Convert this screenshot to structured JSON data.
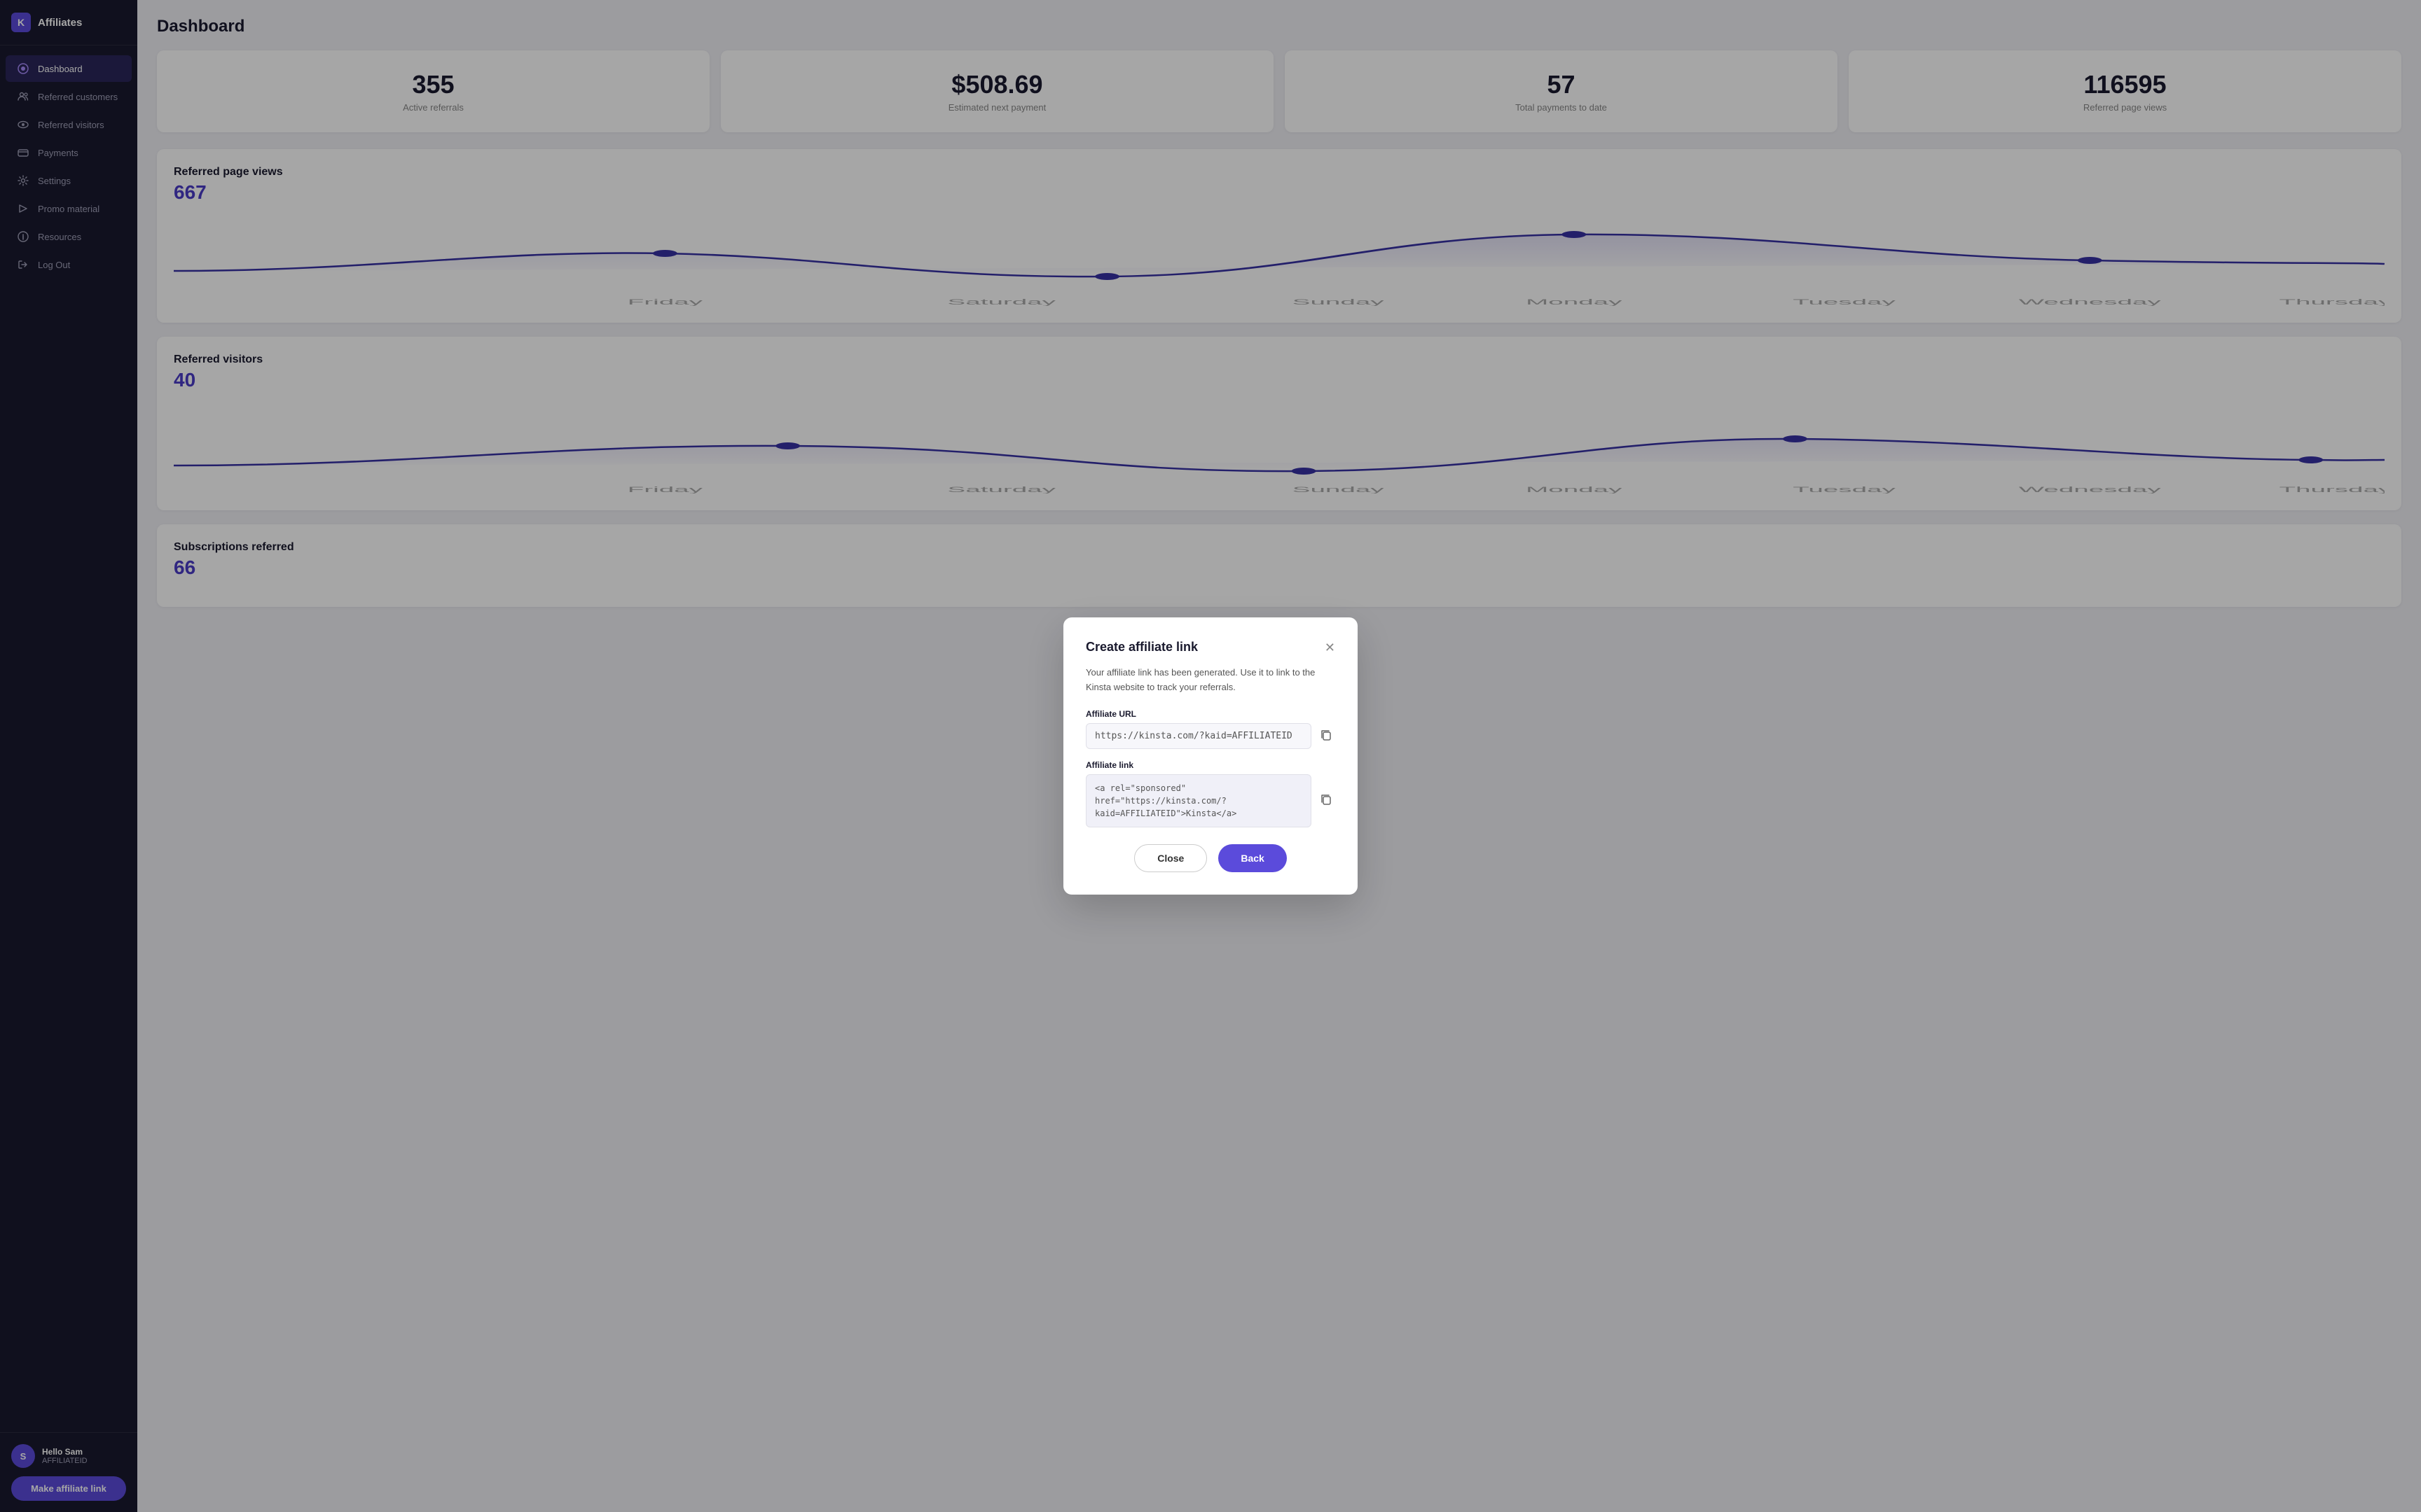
{
  "sidebar": {
    "logo_letter": "K",
    "app_name": "Affiliates",
    "nav_items": [
      {
        "id": "dashboard",
        "label": "Dashboard",
        "active": true,
        "icon": "dashboard"
      },
      {
        "id": "referred-customers",
        "label": "Referred customers",
        "active": false,
        "icon": "people"
      },
      {
        "id": "referred-visitors",
        "label": "Referred visitors",
        "active": false,
        "icon": "eye"
      },
      {
        "id": "payments",
        "label": "Payments",
        "active": false,
        "icon": "payments"
      },
      {
        "id": "settings",
        "label": "Settings",
        "active": false,
        "icon": "gear"
      },
      {
        "id": "promo-material",
        "label": "Promo material",
        "active": false,
        "icon": "promo"
      },
      {
        "id": "resources",
        "label": "Resources",
        "active": false,
        "icon": "resources"
      },
      {
        "id": "logout",
        "label": "Log Out",
        "active": false,
        "icon": "logout"
      }
    ],
    "user_name": "Hello Sam",
    "user_id": "AFFILIATEID",
    "make_link_label": "Make affiliate link"
  },
  "page": {
    "title": "Dashboard"
  },
  "stats": [
    {
      "value": "355",
      "label": "Active referrals"
    },
    {
      "value": "$508.69",
      "label": "Estimated next payment"
    },
    {
      "value": "57",
      "label": "Total payments to date"
    },
    {
      "value": "116595",
      "label": "Referred page views"
    }
  ],
  "charts": [
    {
      "id": "page-views",
      "title": "Referred page views",
      "value": "667",
      "days": [
        "Friday",
        "Saturday",
        "Sunday",
        "Monday",
        "Tuesday",
        "Wednesday",
        "Thursday"
      ]
    },
    {
      "id": "visitors",
      "title": "Referred visitors",
      "value": "40",
      "days": [
        "Friday",
        "Saturday",
        "Sunday",
        "Monday",
        "Tuesday",
        "Wednesday",
        "Thursday"
      ]
    },
    {
      "id": "subscriptions",
      "title": "Subscriptions referred",
      "value": "66",
      "days": []
    }
  ],
  "modal": {
    "title": "Create affiliate link",
    "description": "Your affiliate link has been generated. Use it to link to the Kinsta website to track your referrals.",
    "url_label": "Affiliate URL",
    "url_value": "https://kinsta.com/?kaid=AFFILIATEID",
    "link_label": "Affiliate link",
    "link_value": "<a rel=\"sponsored\"\nhref=\"https://kinsta.com/?\nkaid=AFFILIATEID\">Kinsta</a>",
    "close_label": "Close",
    "back_label": "Back"
  }
}
